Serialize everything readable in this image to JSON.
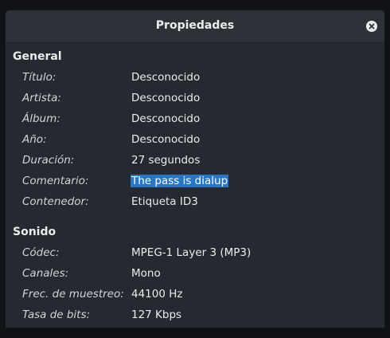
{
  "window": {
    "title": "Propiedades"
  },
  "general": {
    "heading": "General",
    "rows": [
      {
        "label": "Título:",
        "value": "Desconocido"
      },
      {
        "label": "Artista:",
        "value": "Desconocido"
      },
      {
        "label": "Álbum:",
        "value": "Desconocido"
      },
      {
        "label": "Año:",
        "value": "Desconocido"
      },
      {
        "label": "Duración:",
        "value": "27 segundos"
      },
      {
        "label": "Comentario:",
        "value": "The pass is dialup"
      },
      {
        "label": "Contenedor:",
        "value": "Etiqueta ID3"
      }
    ]
  },
  "sound": {
    "heading": "Sonido",
    "rows": [
      {
        "label": "Códec:",
        "value": "MPEG-1 Layer 3 (MP3)"
      },
      {
        "label": "Canales:",
        "value": "Mono"
      },
      {
        "label": "Frec. de muestreo:",
        "value": "44100 Hz"
      },
      {
        "label": "Tasa de bits:",
        "value": "127 Kbps"
      }
    ]
  },
  "icons": {
    "close": "close-icon"
  },
  "colors": {
    "background": "#252a30",
    "titlebar": "#2c3238",
    "selection": "#2a76c6"
  }
}
